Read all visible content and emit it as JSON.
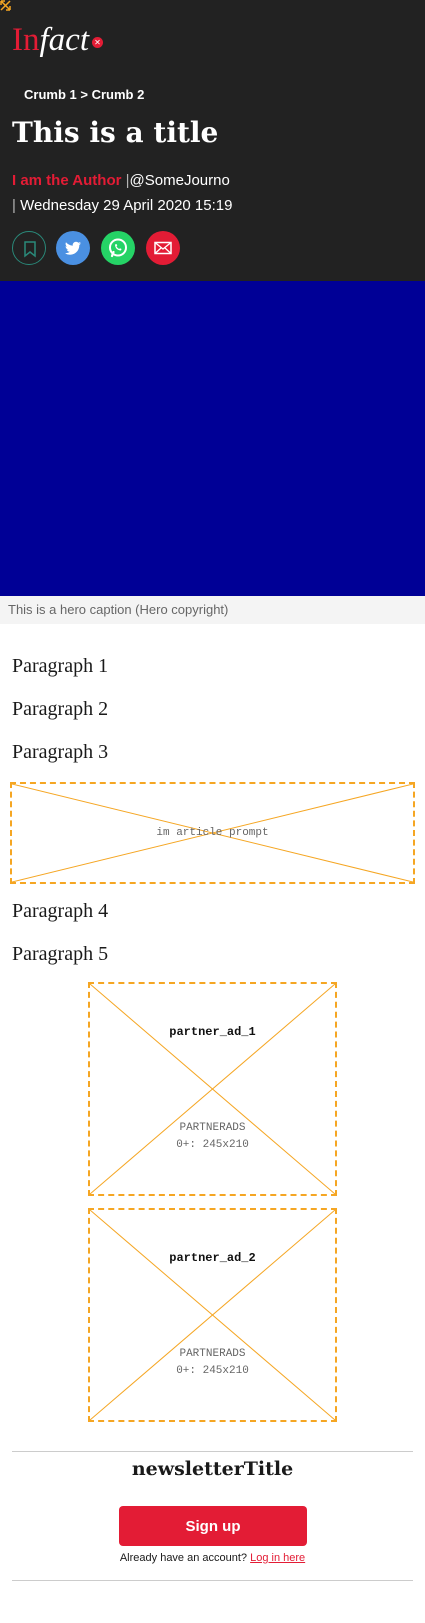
{
  "header": {
    "logo": {
      "part1": "In",
      "part2": "fact"
    },
    "breadcrumb": {
      "crumb1": "Crumb 1",
      "separator": ">",
      "crumb2": "Crumb 2"
    },
    "title": "This is a title",
    "author": "I am the Author",
    "byline_separator": "|",
    "handle": "@SomeJourno",
    "date": "Wednesday 29 April 2020 15:19"
  },
  "share": {
    "icons": [
      "bookmark-icon",
      "twitter-icon",
      "whatsapp-icon",
      "email-icon"
    ],
    "colors": {
      "twitter": "#4a90e2",
      "whatsapp": "#25d366",
      "email": "#e31c35",
      "bookmark": "#2a8a7a"
    }
  },
  "hero": {
    "color": "#000096",
    "caption": "This is a hero caption (Hero copyright)"
  },
  "article": {
    "paragraphs": [
      "Paragraph 1",
      "Paragraph 2",
      "Paragraph 3",
      "Paragraph 4",
      "Paragraph 5"
    ],
    "prompt_placeholder": "im article prompt"
  },
  "ads": [
    {
      "name": "partner_ad_1",
      "label": "PARTNERADS",
      "size": "0+: 245x210"
    },
    {
      "name": "partner_ad_2",
      "label": "PARTNERADS",
      "size": "0+: 245x210"
    }
  ],
  "newsletter": {
    "title": "newsletterTitle",
    "signup_label": "Sign up",
    "login_prompt": "Already have an account?",
    "login_link": "Log in here"
  },
  "colors": {
    "accent": "#e31c35",
    "header_bg": "#222222",
    "placeholder_border": "#f5a623"
  }
}
